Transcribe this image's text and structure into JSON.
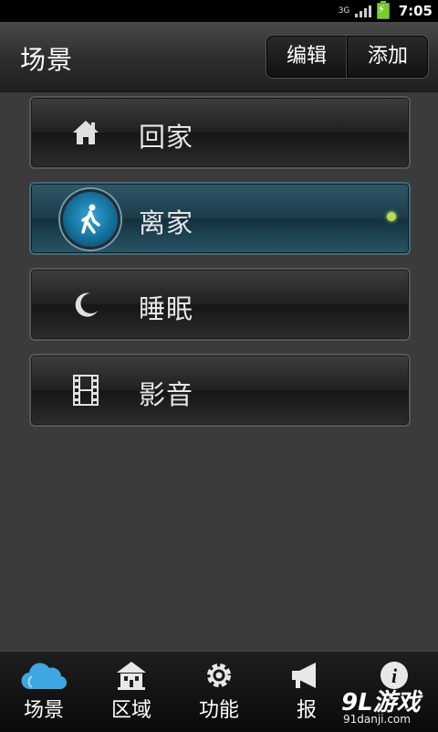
{
  "statusbar": {
    "network": "3G",
    "time": "7:05"
  },
  "header": {
    "title": "场景",
    "edit_label": "编辑",
    "add_label": "添加"
  },
  "scenes": [
    {
      "label": "回家",
      "icon": "home-icon"
    },
    {
      "label": "离家",
      "icon": "walk-icon",
      "active": true
    },
    {
      "label": "睡眠",
      "icon": "moon-icon"
    },
    {
      "label": "影音",
      "icon": "film-icon"
    }
  ],
  "tabs": [
    {
      "label": "场景",
      "icon": "cloud-icon"
    },
    {
      "label": "区域",
      "icon": "house-icon"
    },
    {
      "label": "功能",
      "icon": "gear-icon"
    },
    {
      "label": "报",
      "icon": "megaphone-icon"
    },
    {
      "label": "",
      "icon": "info-icon"
    }
  ],
  "watermark": {
    "brand": "9L游戏",
    "site": "91danji.com"
  },
  "colors": {
    "accent": "#1c3b48",
    "active_dot": "#b6dd55",
    "tab_cloud": "#3fa7e0"
  }
}
